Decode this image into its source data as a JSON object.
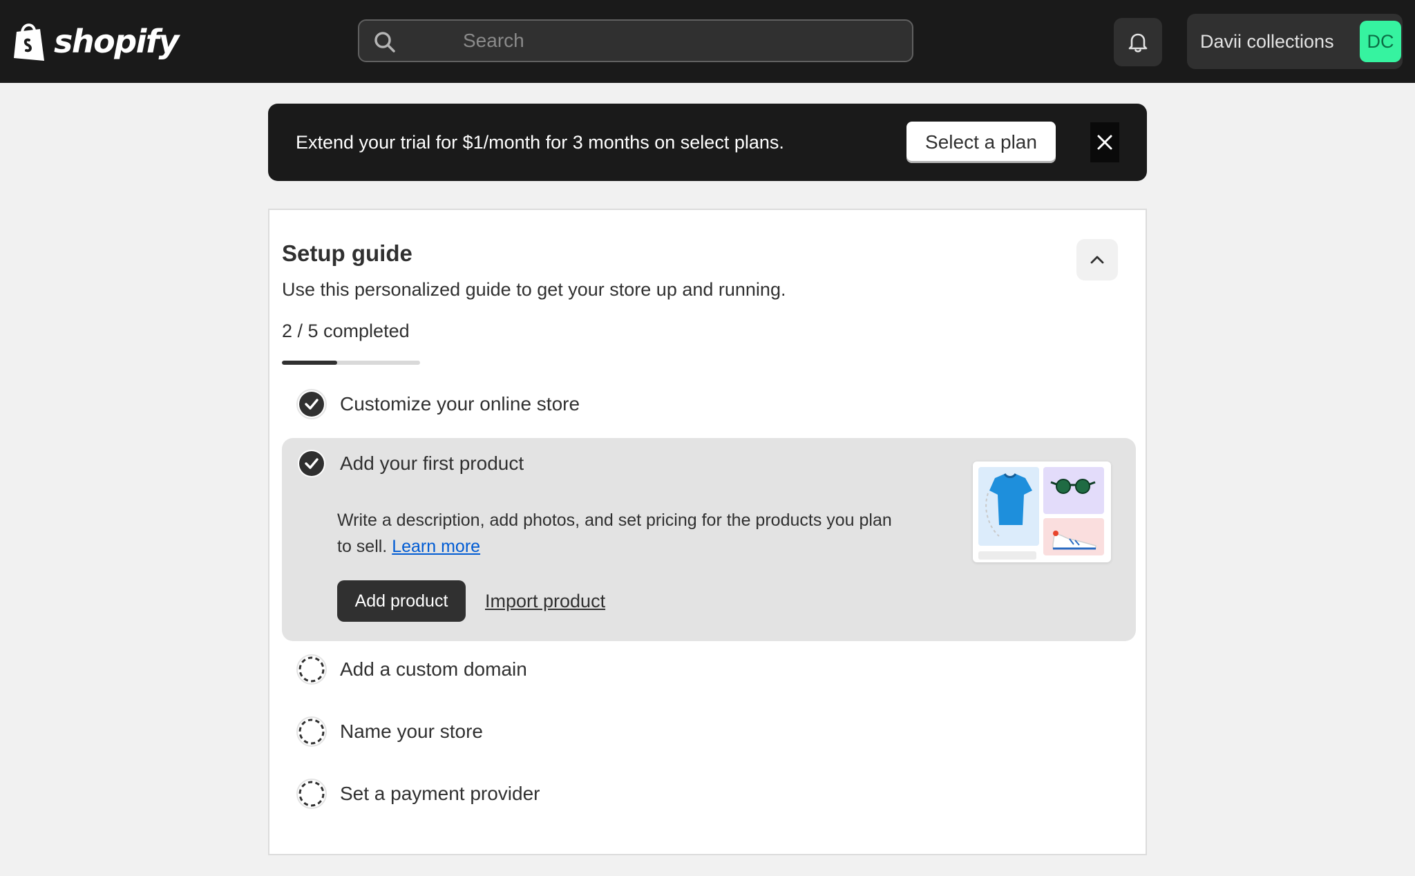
{
  "topbar": {
    "logo_text": "shopify",
    "search": {
      "placeholder": "Search",
      "value": ""
    },
    "store_name": "Davii collections",
    "avatar_initials": "DC",
    "avatar_color": "#36f3a0"
  },
  "banner": {
    "text": "Extend your trial for $1/month for 3 months on select plans.",
    "button_label": "Select a plan"
  },
  "setup_guide": {
    "title": "Setup guide",
    "subtitle": "Use this personalized guide to get your store up and running.",
    "progress_text": "2 / 5 completed",
    "progress": {
      "completed": 2,
      "total": 5
    },
    "tasks": [
      {
        "label": "Customize your online store",
        "done": true
      },
      {
        "label": "Add your first product",
        "done": true,
        "expanded": true,
        "description": "Write a description, add photos, and set pricing for the products you plan to sell.",
        "learn_more": "Learn more",
        "primary_action": "Add product",
        "secondary_action": "Import product"
      },
      {
        "label": "Add a custom domain",
        "done": false
      },
      {
        "label": "Name your store",
        "done": false
      },
      {
        "label": "Set a payment provider",
        "done": false
      }
    ]
  },
  "icons": {
    "search": "search-icon",
    "bell": "bell-icon",
    "close": "close-icon",
    "collapse": "chevron-up-icon",
    "check": "check-circle-icon",
    "todo": "dashed-circle-icon"
  },
  "colors": {
    "topbar": "#1a1a1a",
    "page_bg": "#f1f1f1",
    "link": "#005bd3",
    "avatar": "#36f3a0"
  }
}
